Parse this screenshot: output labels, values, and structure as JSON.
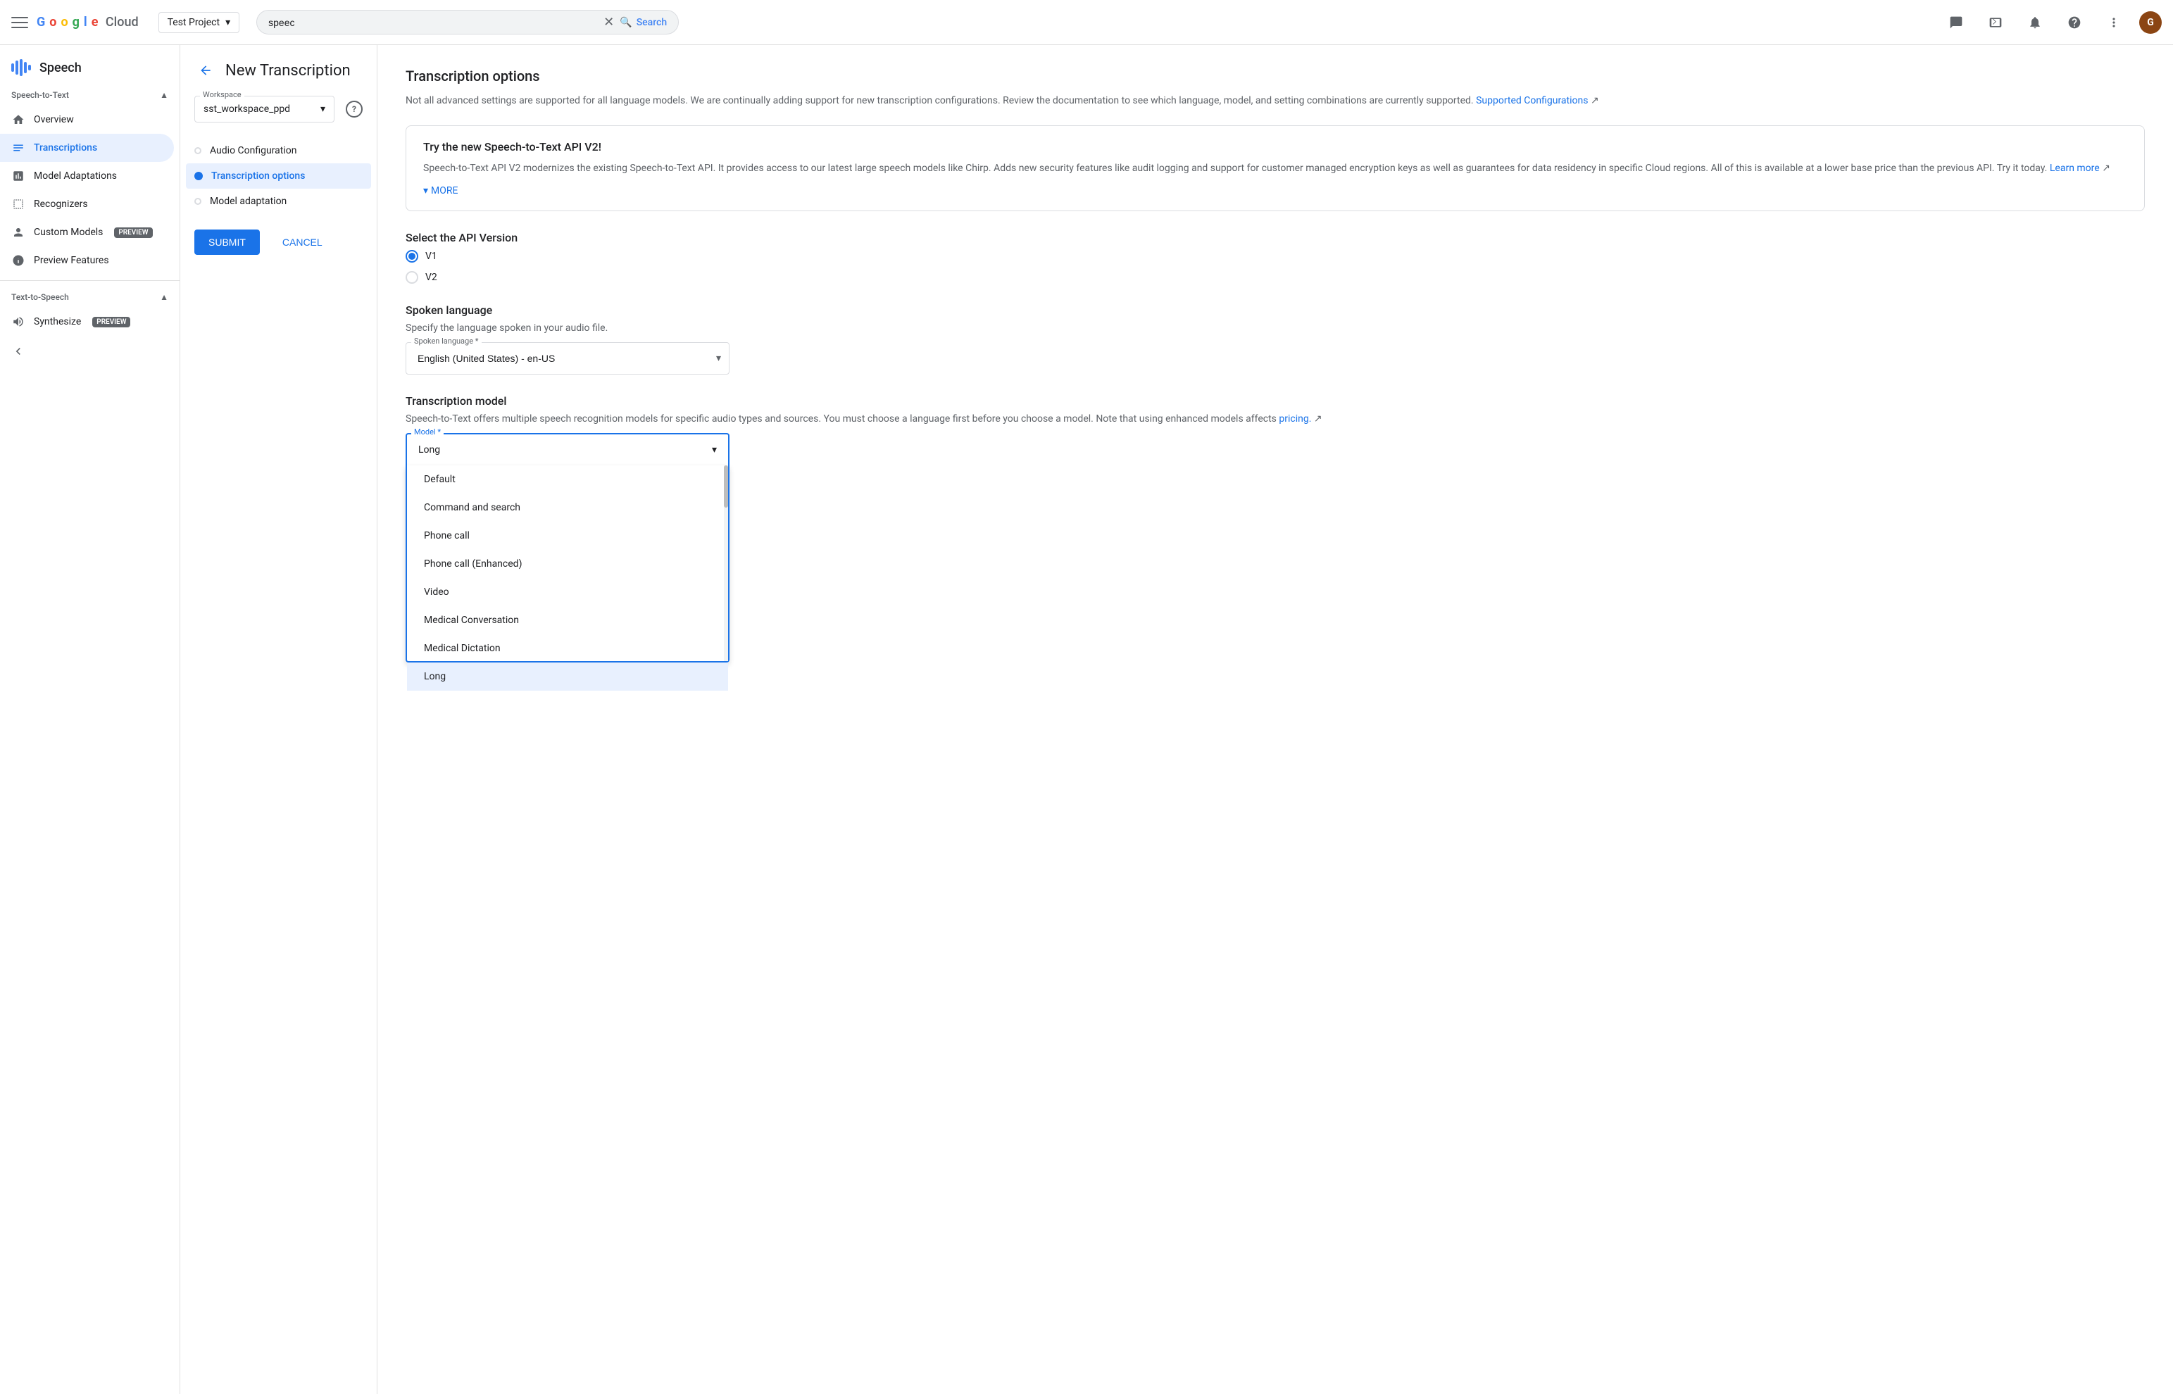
{
  "topbar": {
    "project": {
      "name": "Test Project",
      "dropdown_icon": "▾"
    },
    "search": {
      "value": "speec",
      "placeholder": "Search",
      "button_label": "Search"
    },
    "avatar_initial": "G"
  },
  "sidebar": {
    "product_name": "Speech",
    "speech_to_text": {
      "label": "Speech-to-Text",
      "items": [
        {
          "id": "overview",
          "label": "Overview",
          "icon": "home"
        },
        {
          "id": "transcriptions",
          "label": "Transcriptions",
          "icon": "list",
          "active": true
        },
        {
          "id": "model-adaptations",
          "label": "Model Adaptations",
          "icon": "chart"
        },
        {
          "id": "recognizers",
          "label": "Recognizers",
          "icon": "bars"
        },
        {
          "id": "custom-models",
          "label": "Custom Models",
          "icon": "person",
          "badge": "PREVIEW"
        },
        {
          "id": "preview-features",
          "label": "Preview Features",
          "icon": "eye"
        }
      ]
    },
    "text_to_speech": {
      "label": "Text-to-Speech",
      "items": [
        {
          "id": "synthesize",
          "label": "Synthesize",
          "icon": "waveform",
          "badge": "PREVIEW"
        }
      ]
    }
  },
  "wizard": {
    "back_label": "←",
    "title": "New Transcription",
    "workspace": {
      "label": "Workspace",
      "value": "sst_workspace_ppd"
    },
    "steps": [
      {
        "id": "audio-config",
        "label": "Audio Configuration",
        "state": "inactive"
      },
      {
        "id": "transcription-options",
        "label": "Transcription options",
        "state": "active"
      },
      {
        "id": "model-adaptation",
        "label": "Model adaptation",
        "state": "inactive"
      }
    ],
    "submit_label": "SUBMIT",
    "cancel_label": "CANCEL"
  },
  "content": {
    "title": "Transcription options",
    "description": "Not all advanced settings are supported for all language models. We are continually adding support for new transcription configurations. Review the documentation to see which language, model, and setting combinations are currently supported.",
    "supported_link": "Supported Configurations",
    "info_box": {
      "title": "Try the new Speech-to-Text API V2!",
      "description": "Speech-to-Text API V2 modernizes the existing Speech-to-Text API. It provides access to our latest large speech models like Chirp. Adds new security features like audit logging and support for customer managed encryption keys as well as guarantees for data residency in specific Cloud regions. All of this is available at a lower base price than the previous API. Try it today.",
      "learn_more": "Learn more",
      "more_label": "MORE"
    },
    "api_version": {
      "label": "Select the API Version",
      "options": [
        {
          "value": "V1",
          "label": "V1",
          "selected": true
        },
        {
          "value": "V2",
          "label": "V2",
          "selected": false
        }
      ]
    },
    "spoken_language": {
      "label": "Spoken language",
      "sublabel": "Specify the language spoken in your audio file.",
      "field_label": "Spoken language *",
      "value": "English (United States) - en-US"
    },
    "transcription_model": {
      "label": "Transcription model",
      "sublabel_prefix": "Speech-to-Text offers multiple speech recognition models for specific audio types and sources. You must choose a language first before you choose a model. Note that using enhanced models affects",
      "pricing_link": "pricing.",
      "field_label": "Model *",
      "options": [
        {
          "value": "default",
          "label": "Default",
          "selected": false
        },
        {
          "value": "command-search",
          "label": "Command and search",
          "selected": false
        },
        {
          "value": "phone-call",
          "label": "Phone call",
          "selected": false
        },
        {
          "value": "phone-call-enhanced",
          "label": "Phone call (Enhanced)",
          "selected": false
        },
        {
          "value": "video",
          "label": "Video",
          "selected": false
        },
        {
          "value": "medical-conversation",
          "label": "Medical Conversation",
          "selected": false
        },
        {
          "value": "medical-dictation",
          "label": "Medical Dictation",
          "selected": false
        },
        {
          "value": "long",
          "label": "Long",
          "selected": true
        }
      ]
    }
  }
}
